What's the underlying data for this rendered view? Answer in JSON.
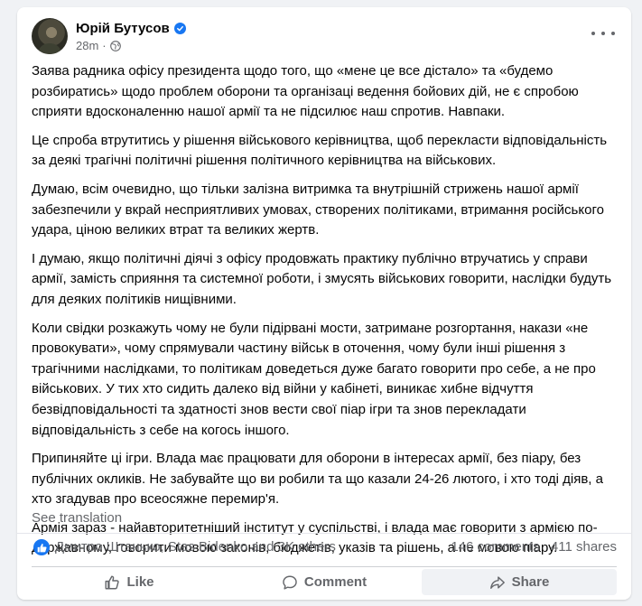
{
  "post": {
    "author": "Юрій Бутусов",
    "time": "28m",
    "paragraphs": [
      "Заява радника офісу президента щодо того, що «мене це все дістало» та «будемо розбиратись» щодо проблем оборони та організаці ведення бойових дій, не є спробою сприяти вдосконаленню нашої армії та не підсилює наш спротив. Навпаки.",
      "Це спроба втрутитись у рішення військового керівництва, щоб перекласти  відповідальність за деякі трагічні політичні рішення політичного керівництва на військових.",
      "Думаю, всім очевидно, що тільки залізна витримка та внутрішній стрижень нашої армії забезпечили у вкрай несприятливих умовах, створених політиками, втримання російського удара, ціною великих втрат та великих жертв.",
      "І думаю, якщо політичні діячі з офісу продовжать практику публічно втручатись у справи армії, замість сприяння та системної роботи, і змусять військових говорити, наслідки будуть для деяких політиків нищівними.",
      "Коли свідки розкажуть чому не були підірвані мости, затримане розгортання, накази «не провокувати», чому спрямували частину військ в оточення, чому були інші рішення з трагічними наслідками, то політикам доведеться дуже багато говорити про себе, а не про військових. У тих хто сидить далеко від війни у кабінеті, виникає хибне відчуття безвідповідальності та здатності знов вести свої піар ігри та знов перекладати відповідальність з себе на когось іншого.",
      "Припиняйте ці ігри. Влада має працювати для оборони в інтересах армії, без піару, без публічних окликів. Не забувайте що ви робили та що казали 24-26 лютого, і хто тоді діяв, а хто згадував про всеосяжне перемир'я.",
      "Армія зараз - найавторитетніший інститут у суспільстві, і влада має говорити з армією по-державному, говорити мовою законів, бюджетів, указів та рішень, а не мовою піару."
    ],
    "see_translation": "See translation",
    "reactions": "Дмитро Штанько, Stas Bidenko and 3K others",
    "comments_count": "146 comments",
    "shares_count": "411 shares",
    "actions": {
      "like": "Like",
      "comment": "Comment",
      "share": "Share"
    }
  },
  "colors": {
    "accent": "#1877f2",
    "secondary_text": "#65676b",
    "background": "#f0f2f5"
  },
  "icons": [
    "verified-badge-icon",
    "globe-icon",
    "more-options-icon",
    "like-reaction-icon",
    "thumbs-up-icon",
    "comment-icon",
    "share-icon"
  ]
}
